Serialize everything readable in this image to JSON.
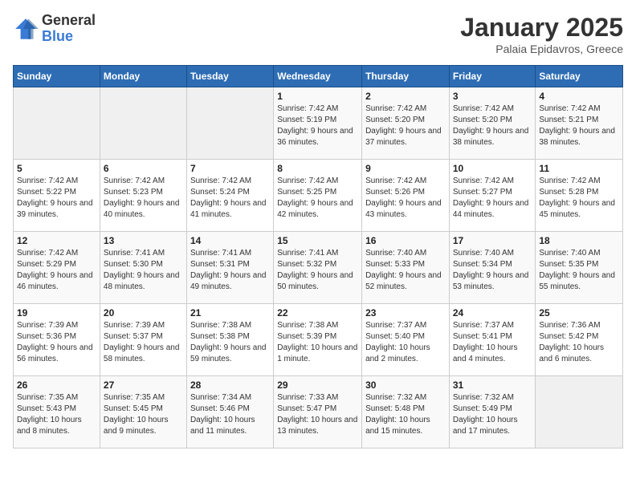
{
  "logo": {
    "general": "General",
    "blue": "Blue"
  },
  "header": {
    "title": "January 2025",
    "subtitle": "Palaia Epidavros, Greece"
  },
  "days_of_week": [
    "Sunday",
    "Monday",
    "Tuesday",
    "Wednesday",
    "Thursday",
    "Friday",
    "Saturday"
  ],
  "weeks": [
    [
      {
        "day": "",
        "info": ""
      },
      {
        "day": "",
        "info": ""
      },
      {
        "day": "",
        "info": ""
      },
      {
        "day": "1",
        "info": "Sunrise: 7:42 AM\nSunset: 5:19 PM\nDaylight: 9 hours and 36 minutes."
      },
      {
        "day": "2",
        "info": "Sunrise: 7:42 AM\nSunset: 5:20 PM\nDaylight: 9 hours and 37 minutes."
      },
      {
        "day": "3",
        "info": "Sunrise: 7:42 AM\nSunset: 5:20 PM\nDaylight: 9 hours and 38 minutes."
      },
      {
        "day": "4",
        "info": "Sunrise: 7:42 AM\nSunset: 5:21 PM\nDaylight: 9 hours and 38 minutes."
      }
    ],
    [
      {
        "day": "5",
        "info": "Sunrise: 7:42 AM\nSunset: 5:22 PM\nDaylight: 9 hours and 39 minutes."
      },
      {
        "day": "6",
        "info": "Sunrise: 7:42 AM\nSunset: 5:23 PM\nDaylight: 9 hours and 40 minutes."
      },
      {
        "day": "7",
        "info": "Sunrise: 7:42 AM\nSunset: 5:24 PM\nDaylight: 9 hours and 41 minutes."
      },
      {
        "day": "8",
        "info": "Sunrise: 7:42 AM\nSunset: 5:25 PM\nDaylight: 9 hours and 42 minutes."
      },
      {
        "day": "9",
        "info": "Sunrise: 7:42 AM\nSunset: 5:26 PM\nDaylight: 9 hours and 43 minutes."
      },
      {
        "day": "10",
        "info": "Sunrise: 7:42 AM\nSunset: 5:27 PM\nDaylight: 9 hours and 44 minutes."
      },
      {
        "day": "11",
        "info": "Sunrise: 7:42 AM\nSunset: 5:28 PM\nDaylight: 9 hours and 45 minutes."
      }
    ],
    [
      {
        "day": "12",
        "info": "Sunrise: 7:42 AM\nSunset: 5:29 PM\nDaylight: 9 hours and 46 minutes."
      },
      {
        "day": "13",
        "info": "Sunrise: 7:41 AM\nSunset: 5:30 PM\nDaylight: 9 hours and 48 minutes."
      },
      {
        "day": "14",
        "info": "Sunrise: 7:41 AM\nSunset: 5:31 PM\nDaylight: 9 hours and 49 minutes."
      },
      {
        "day": "15",
        "info": "Sunrise: 7:41 AM\nSunset: 5:32 PM\nDaylight: 9 hours and 50 minutes."
      },
      {
        "day": "16",
        "info": "Sunrise: 7:40 AM\nSunset: 5:33 PM\nDaylight: 9 hours and 52 minutes."
      },
      {
        "day": "17",
        "info": "Sunrise: 7:40 AM\nSunset: 5:34 PM\nDaylight: 9 hours and 53 minutes."
      },
      {
        "day": "18",
        "info": "Sunrise: 7:40 AM\nSunset: 5:35 PM\nDaylight: 9 hours and 55 minutes."
      }
    ],
    [
      {
        "day": "19",
        "info": "Sunrise: 7:39 AM\nSunset: 5:36 PM\nDaylight: 9 hours and 56 minutes."
      },
      {
        "day": "20",
        "info": "Sunrise: 7:39 AM\nSunset: 5:37 PM\nDaylight: 9 hours and 58 minutes."
      },
      {
        "day": "21",
        "info": "Sunrise: 7:38 AM\nSunset: 5:38 PM\nDaylight: 9 hours and 59 minutes."
      },
      {
        "day": "22",
        "info": "Sunrise: 7:38 AM\nSunset: 5:39 PM\nDaylight: 10 hours and 1 minute."
      },
      {
        "day": "23",
        "info": "Sunrise: 7:37 AM\nSunset: 5:40 PM\nDaylight: 10 hours and 2 minutes."
      },
      {
        "day": "24",
        "info": "Sunrise: 7:37 AM\nSunset: 5:41 PM\nDaylight: 10 hours and 4 minutes."
      },
      {
        "day": "25",
        "info": "Sunrise: 7:36 AM\nSunset: 5:42 PM\nDaylight: 10 hours and 6 minutes."
      }
    ],
    [
      {
        "day": "26",
        "info": "Sunrise: 7:35 AM\nSunset: 5:43 PM\nDaylight: 10 hours and 8 minutes."
      },
      {
        "day": "27",
        "info": "Sunrise: 7:35 AM\nSunset: 5:45 PM\nDaylight: 10 hours and 9 minutes."
      },
      {
        "day": "28",
        "info": "Sunrise: 7:34 AM\nSunset: 5:46 PM\nDaylight: 10 hours and 11 minutes."
      },
      {
        "day": "29",
        "info": "Sunrise: 7:33 AM\nSunset: 5:47 PM\nDaylight: 10 hours and 13 minutes."
      },
      {
        "day": "30",
        "info": "Sunrise: 7:32 AM\nSunset: 5:48 PM\nDaylight: 10 hours and 15 minutes."
      },
      {
        "day": "31",
        "info": "Sunrise: 7:32 AM\nSunset: 5:49 PM\nDaylight: 10 hours and 17 minutes."
      },
      {
        "day": "",
        "info": ""
      }
    ]
  ]
}
